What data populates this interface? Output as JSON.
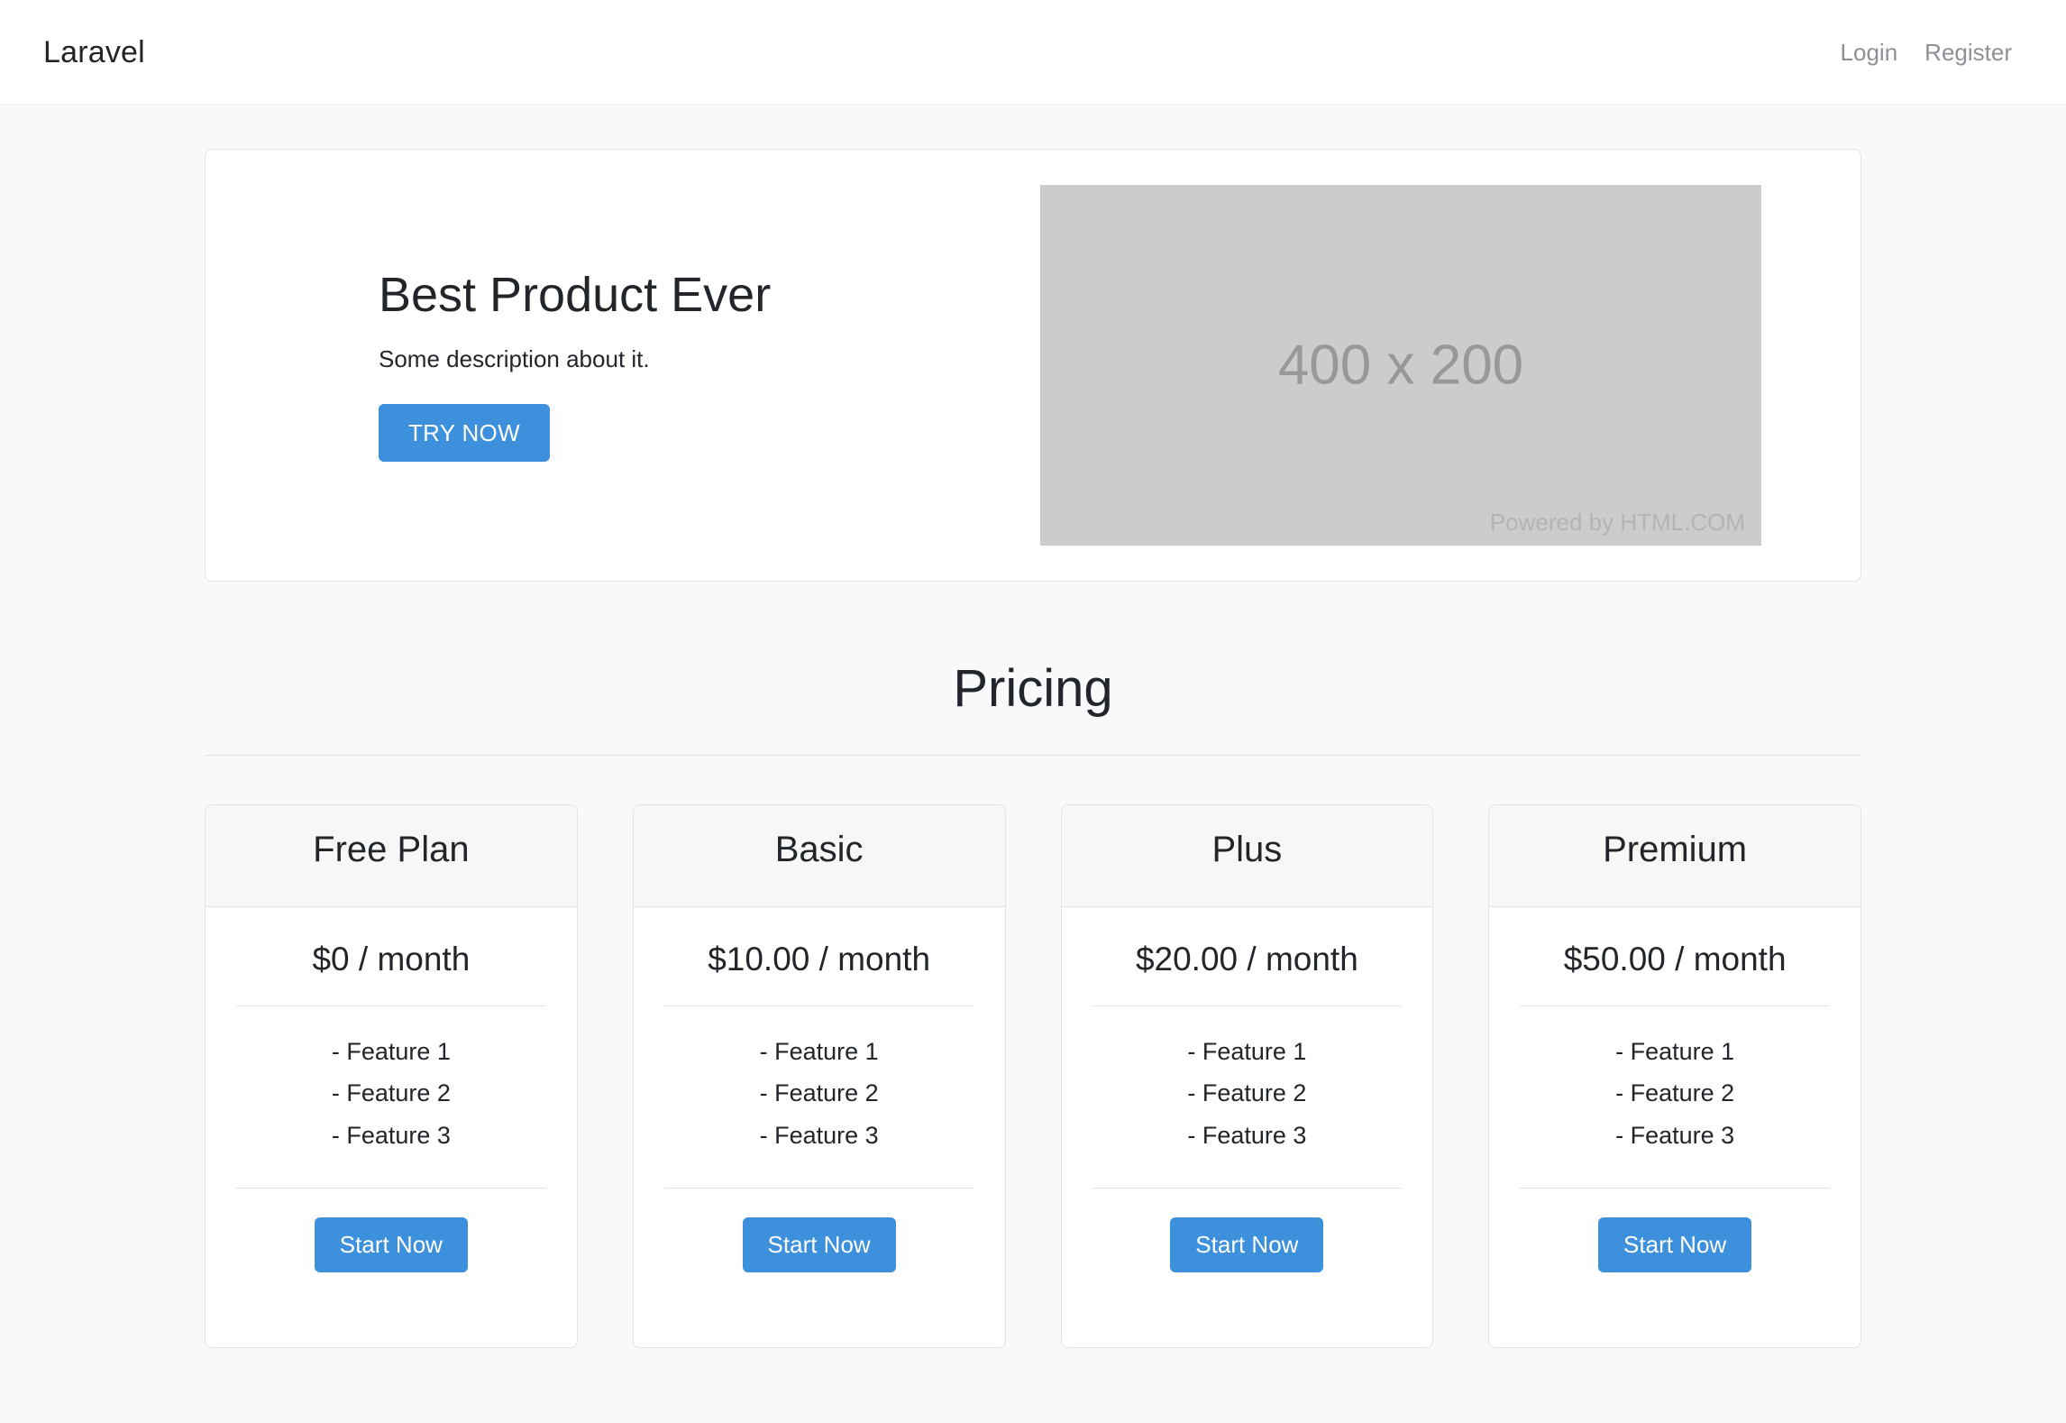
{
  "navbar": {
    "brand": "Laravel",
    "links": [
      {
        "label": "Login"
      },
      {
        "label": "Register"
      }
    ]
  },
  "hero": {
    "title": "Best Product Ever",
    "description": "Some description about it.",
    "cta_label": "TRY NOW",
    "image": {
      "dimensions_label": "400 x 200",
      "credit_label": "Powered by HTML.COM",
      "background_color": "#cccccc"
    }
  },
  "pricing": {
    "heading": "Pricing",
    "plans": [
      {
        "title": "Free Plan",
        "price": "$0 / month",
        "features": [
          "- Feature 1",
          "- Feature 2",
          "- Feature 3"
        ],
        "cta_label": "Start Now"
      },
      {
        "title": "Basic",
        "price": "$10.00 / month",
        "features": [
          "- Feature 1",
          "- Feature 2",
          "- Feature 3"
        ],
        "cta_label": "Start Now"
      },
      {
        "title": "Plus",
        "price": "$20.00 / month",
        "features": [
          "- Feature 1",
          "- Feature 2",
          "- Feature 3"
        ],
        "cta_label": "Start Now"
      },
      {
        "title": "Premium",
        "price": "$50.00 / month",
        "features": [
          "- Feature 1",
          "- Feature 2",
          "- Feature 3"
        ],
        "cta_label": "Start Now"
      }
    ]
  },
  "colors": {
    "accent": "#3d90db",
    "page_background": "#f8f9fa",
    "card_background": "#ffffff",
    "card_header_background": "#f6f7f7",
    "border": "#e0e2e4",
    "text": "#22262a",
    "muted_text": "#8d9096"
  }
}
